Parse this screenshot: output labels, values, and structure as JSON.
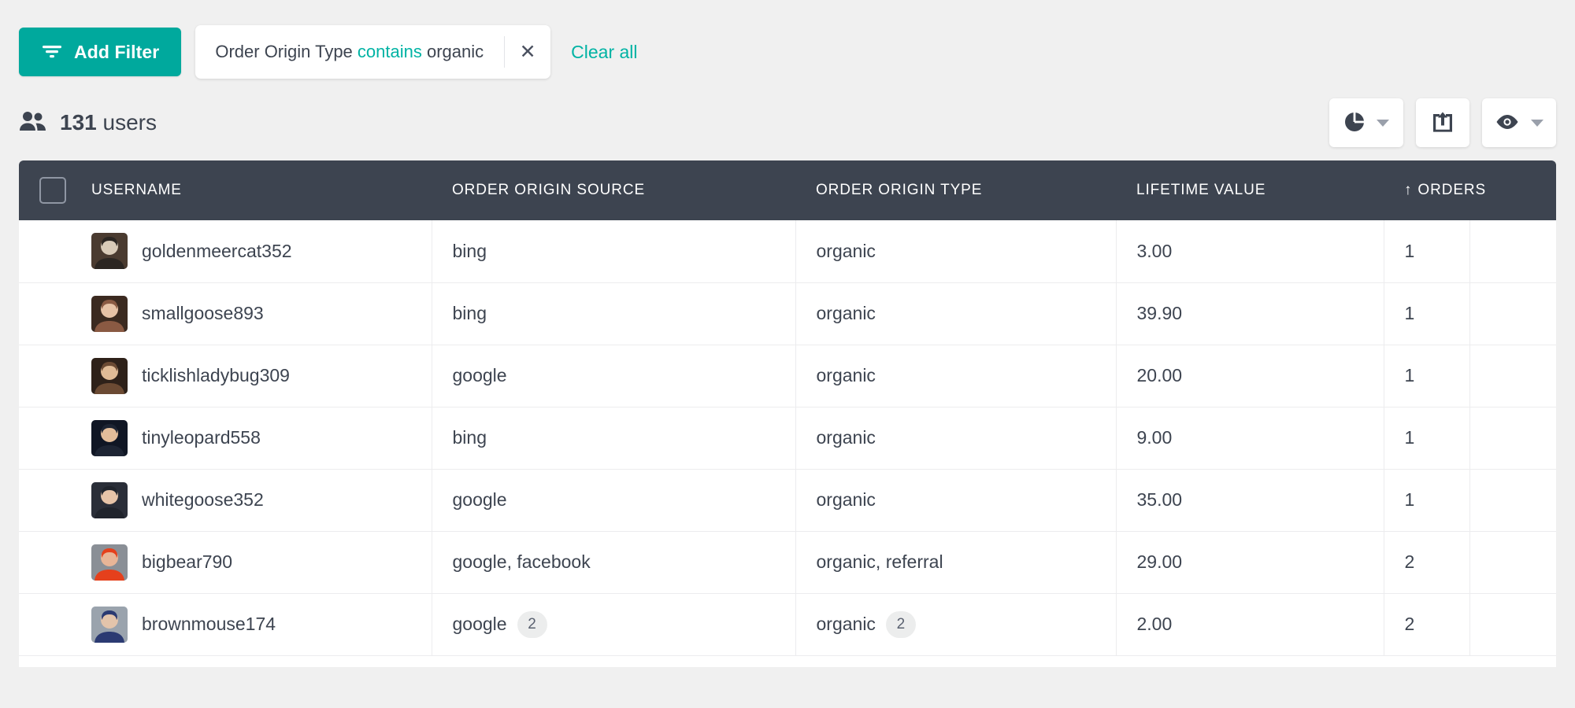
{
  "colors": {
    "accent": "#00a99d",
    "link": "#00b3a4",
    "header_bg": "#3d4450",
    "page_bg": "#f0f0f0",
    "text": "#3d4450",
    "badge_bg": "#eceded"
  },
  "filter_bar": {
    "add_filter_label": "Add Filter",
    "add_filter_icon": "filter-icon",
    "chip": {
      "field": "Order Origin Type",
      "operator": "contains",
      "value": "organic",
      "remove_icon": "close-icon",
      "remove_label": "✕"
    },
    "clear_all_label": "Clear all"
  },
  "summary": {
    "users_icon": "users-icon",
    "count": "131",
    "unit": "users"
  },
  "toolbar": {
    "buttons": [
      {
        "name": "chart-view-button",
        "icon": "pie-chart-icon",
        "has_caret": true
      },
      {
        "name": "export-button",
        "icon": "export-box-icon",
        "has_caret": false
      },
      {
        "name": "visibility-button",
        "icon": "eye-icon",
        "has_caret": true
      }
    ]
  },
  "table": {
    "select_all_checkbox": "unchecked",
    "sort_column": "ORDERS",
    "sort_direction": "asc",
    "sort_indicator": "↑",
    "columns": [
      "USERNAME",
      "ORDER ORIGIN SOURCE",
      "ORDER ORIGIN TYPE",
      "LIFETIME VALUE",
      "ORDERS"
    ],
    "rows": [
      {
        "username": "goldenmeercat352",
        "avatar": "avatar-1",
        "origin_source": "bing",
        "origin_source_badge": "",
        "origin_type": "organic",
        "origin_type_badge": "",
        "lifetime_value": "3.00",
        "orders": "1"
      },
      {
        "username": "smallgoose893",
        "avatar": "avatar-2",
        "origin_source": "bing",
        "origin_source_badge": "",
        "origin_type": "organic",
        "origin_type_badge": "",
        "lifetime_value": "39.90",
        "orders": "1"
      },
      {
        "username": "ticklishladybug309",
        "avatar": "avatar-3",
        "origin_source": "google",
        "origin_source_badge": "",
        "origin_type": "organic",
        "origin_type_badge": "",
        "lifetime_value": "20.00",
        "orders": "1"
      },
      {
        "username": "tinyleopard558",
        "avatar": "avatar-4",
        "origin_source": "bing",
        "origin_source_badge": "",
        "origin_type": "organic",
        "origin_type_badge": "",
        "lifetime_value": "9.00",
        "orders": "1"
      },
      {
        "username": "whitegoose352",
        "avatar": "avatar-5",
        "origin_source": "google",
        "origin_source_badge": "",
        "origin_type": "organic",
        "origin_type_badge": "",
        "lifetime_value": "35.00",
        "orders": "1"
      },
      {
        "username": "bigbear790",
        "avatar": "avatar-6",
        "origin_source": "google, facebook",
        "origin_source_badge": "",
        "origin_type": "organic, referral",
        "origin_type_badge": "",
        "lifetime_value": "29.00",
        "orders": "2"
      },
      {
        "username": "brownmouse174",
        "avatar": "avatar-7",
        "origin_source": "google",
        "origin_source_badge": "2",
        "origin_type": "organic",
        "origin_type_badge": "2",
        "lifetime_value": "2.00",
        "orders": "2"
      }
    ]
  }
}
